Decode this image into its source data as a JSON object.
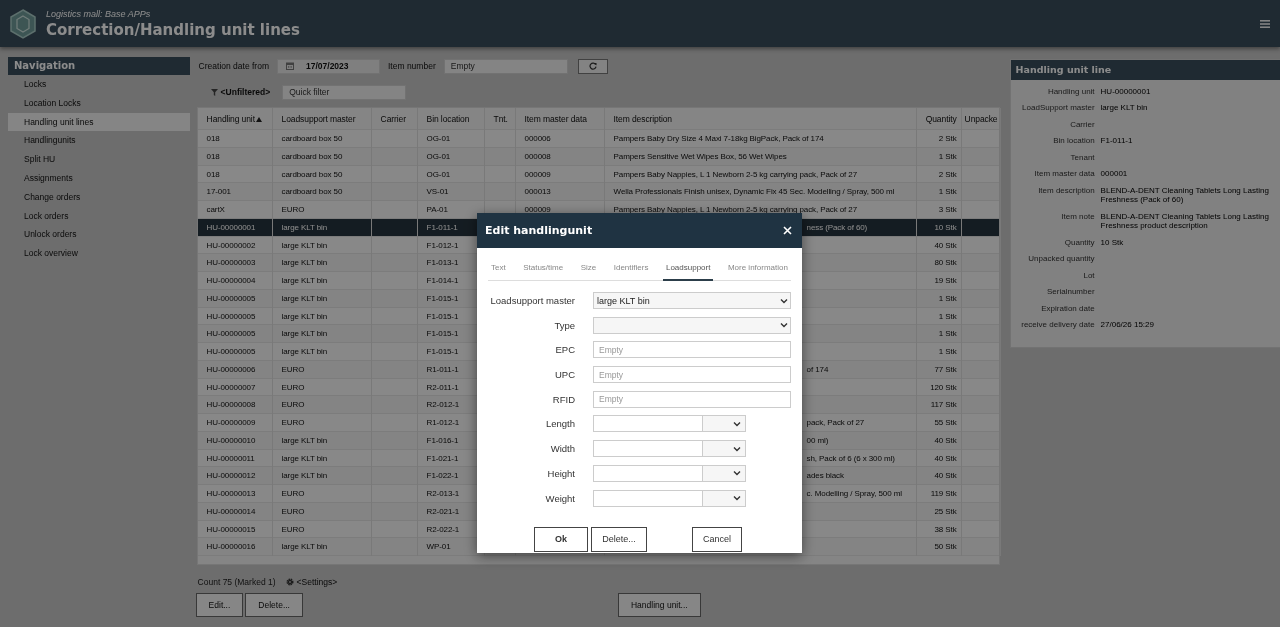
{
  "header": {
    "app_name": "Logistics mall: Base APPs",
    "title": "Correction/Handling unit lines"
  },
  "navigation": {
    "title": "Navigation",
    "items": [
      {
        "label": "Locks",
        "selected": false
      },
      {
        "label": "Location Locks",
        "selected": false
      },
      {
        "label": "Handling unit lines",
        "selected": true
      },
      {
        "label": "Handlingunits",
        "selected": false
      },
      {
        "label": "Split HU",
        "selected": false
      },
      {
        "label": "Assignments",
        "selected": false
      },
      {
        "label": "Change orders",
        "selected": false
      },
      {
        "label": "Lock orders",
        "selected": false
      },
      {
        "label": "Unlock orders",
        "selected": false
      },
      {
        "label": "Lock overview",
        "selected": false
      }
    ]
  },
  "filters": {
    "creation_date_label": "Creation date from",
    "creation_date": "17/07/2023",
    "item_number_label": "Item number",
    "item_number": {
      "placeholder": "Empty"
    },
    "filter_state": "<Unfiltered>",
    "quick_filter": {
      "placeholder": "Quick filter"
    }
  },
  "table": {
    "columns": [
      {
        "label": "Handling unit",
        "sorted": true
      },
      {
        "label": "Loadsupport master",
        "sorted": false
      },
      {
        "label": "Carrier",
        "sorted": false
      },
      {
        "label": "Bin location",
        "sorted": false
      },
      {
        "label": "Tnt.",
        "sorted": false
      },
      {
        "label": "Item master data",
        "sorted": false
      },
      {
        "label": "Item description",
        "sorted": false
      },
      {
        "label": "Quantity",
        "sorted": false
      },
      {
        "label": "Unpacke",
        "sorted": false
      }
    ],
    "rows": [
      {
        "kind": "full",
        "selected": false,
        "handling_unit": "018",
        "loadsupport_master": "cardboard box 50",
        "bin_location": "OG-01",
        "item_master_data": "000006",
        "item_description": "Pampers Baby Dry Size 4 Maxi 7-18kg BigPack, Pack of 174",
        "quantity": "2 Stk"
      },
      {
        "kind": "full",
        "selected": false,
        "handling_unit": "018",
        "loadsupport_master": "cardboard box 50",
        "bin_location": "OG-01",
        "item_master_data": "000008",
        "item_description": "Pampers Sensitive Wet Wipes Box, 56 Wet Wipes",
        "quantity": "1 Stk"
      },
      {
        "kind": "full",
        "selected": false,
        "handling_unit": "018",
        "loadsupport_master": "cardboard box 50",
        "bin_location": "OG-01",
        "item_master_data": "000009",
        "item_description": "Pampers Baby Nappies, L 1 Newborn 2-5 kg carrying pack, Pack of 27",
        "quantity": "2 Stk"
      },
      {
        "kind": "full",
        "selected": false,
        "handling_unit": "17-001",
        "loadsupport_master": "cardboard box 50",
        "bin_location": "VS-01",
        "item_master_data": "000013",
        "item_description": "Wella Professionals Finish unisex, Dynamic Fix 45 Sec. Modelling / Spray, 500 ml",
        "quantity": "1 Stk"
      },
      {
        "kind": "full",
        "selected": false,
        "handling_unit": "cartX",
        "loadsupport_master": "EURO",
        "bin_location": "PA-01",
        "item_master_data": "000009",
        "item_description": "Pampers Baby Nappies, L 1 Newborn 2-5 kg carrying pack, Pack of 27",
        "quantity": "3 Stk"
      },
      {
        "kind": "covered",
        "selected": true,
        "handling_unit": "HU-00000001",
        "loadsupport_master": "large KLT bin",
        "bin_location": "F1-011-1",
        "item_description": "ness (Pack of 60)",
        "quantity": "10 Stk"
      },
      {
        "kind": "covered",
        "selected": false,
        "handling_unit": "HU-00000002",
        "loadsupport_master": "large KLT bin",
        "bin_location": "F1-012-1",
        "quantity": "40 Stk"
      },
      {
        "kind": "covered",
        "selected": false,
        "handling_unit": "HU-00000003",
        "loadsupport_master": "large KLT bin",
        "bin_location": "F1-013-1",
        "quantity": "80 Stk"
      },
      {
        "kind": "covered",
        "selected": false,
        "handling_unit": "HU-00000004",
        "loadsupport_master": "large KLT bin",
        "bin_location": "F1-014-1",
        "quantity": "19 Stk"
      },
      {
        "kind": "covered",
        "selected": false,
        "handling_unit": "HU-00000005",
        "loadsupport_master": "large KLT bin",
        "bin_location": "F1-015-1",
        "quantity": "1 Stk"
      },
      {
        "kind": "covered",
        "selected": false,
        "handling_unit": "HU-00000005",
        "loadsupport_master": "large KLT bin",
        "bin_location": "F1-015-1",
        "quantity": "1 Stk"
      },
      {
        "kind": "covered",
        "selected": false,
        "handling_unit": "HU-00000005",
        "loadsupport_master": "large KLT bin",
        "bin_location": "F1-015-1",
        "quantity": "1 Stk"
      },
      {
        "kind": "covered",
        "selected": false,
        "handling_unit": "HU-00000005",
        "loadsupport_master": "large KLT bin",
        "bin_location": "F1-015-1",
        "quantity": "1 Stk"
      },
      {
        "kind": "covered",
        "selected": false,
        "handling_unit": "HU-00000006",
        "loadsupport_master": "EURO",
        "bin_location": "R1-011-1",
        "item_description": "of 174",
        "quantity": "77 Stk"
      },
      {
        "kind": "covered",
        "selected": false,
        "handling_unit": "HU-00000007",
        "loadsupport_master": "EURO",
        "bin_location": "R2-011-1",
        "quantity": "120 Stk"
      },
      {
        "kind": "covered",
        "selected": false,
        "handling_unit": "HU-00000008",
        "loadsupport_master": "EURO",
        "bin_location": "R2-012-1",
        "quantity": "117 Stk"
      },
      {
        "kind": "covered",
        "selected": false,
        "handling_unit": "HU-00000009",
        "loadsupport_master": "EURO",
        "bin_location": "R1-012-1",
        "item_description": "pack, Pack of 27",
        "quantity": "55 Stk"
      },
      {
        "kind": "covered",
        "selected": false,
        "handling_unit": "HU-00000010",
        "loadsupport_master": "large KLT bin",
        "bin_location": "F1-016-1",
        "item_description": "00 ml)",
        "quantity": "40 Stk"
      },
      {
        "kind": "covered",
        "selected": false,
        "handling_unit": "HU-00000011",
        "loadsupport_master": "large KLT bin",
        "bin_location": "F1-021-1",
        "item_description": "sh, Pack of 6 (6 x 300 ml)",
        "quantity": "40 Stk"
      },
      {
        "kind": "covered",
        "selected": false,
        "handling_unit": "HU-00000012",
        "loadsupport_master": "large KLT bin",
        "bin_location": "F1-022-1",
        "item_description": "ades black",
        "quantity": "40 Stk"
      },
      {
        "kind": "covered",
        "selected": false,
        "handling_unit": "HU-00000013",
        "loadsupport_master": "EURO",
        "bin_location": "R2-013-1",
        "item_description": "c. Modelling / Spray, 500 ml",
        "quantity": "119 Stk"
      },
      {
        "kind": "covered",
        "selected": false,
        "handling_unit": "HU-00000014",
        "loadsupport_master": "EURO",
        "bin_location": "R2-021-1",
        "quantity": "25 Stk"
      },
      {
        "kind": "covered",
        "selected": false,
        "handling_unit": "HU-00000015",
        "loadsupport_master": "EURO",
        "bin_location": "R2-022-1",
        "quantity": "38 Stk"
      },
      {
        "kind": "covered",
        "selected": false,
        "handling_unit": "HU-00000016",
        "loadsupport_master": "large KLT bin",
        "bin_location": "WP-01",
        "quantity": "50 Stk"
      }
    ]
  },
  "footer": {
    "count": "Count 75 (Marked 1)",
    "settings": "<Settings>",
    "buttons": [
      "Edit...",
      "Delete...",
      "Handling unit..."
    ]
  },
  "detail": {
    "title": "Handling unit line",
    "fields": [
      {
        "label": "Handling unit",
        "value": "HU-00000001"
      },
      {
        "label": "LoadSupport master",
        "value": "large KLT bin"
      },
      {
        "label": "Carrier"
      },
      {
        "label": "Bin location",
        "value": "F1-011-1"
      },
      {
        "label": "Tenant"
      },
      {
        "label": "Item master data",
        "value": "000001"
      },
      {
        "label": "Item description",
        "value": "BLEND-A-DENT Cleaning Tablets Long Lasting Freshness (Pack of 60)"
      },
      {
        "label": "Item note",
        "value": "BLEND-A-DENT Cleaning Tablets Long Lasting Freshness product description"
      },
      {
        "label": "Quantity",
        "value": "10 Stk"
      },
      {
        "label": "Unpacked quantity"
      },
      {
        "label": "Lot"
      },
      {
        "label": "Serialnumber"
      },
      {
        "label": "Expiration date"
      },
      {
        "label": "receive delivery date",
        "value": "27/06/26 15:29"
      }
    ]
  },
  "dialog": {
    "title": "Edit handlingunit",
    "tabs": [
      {
        "label": "Text",
        "selected": false
      },
      {
        "label": "Status/time",
        "selected": false
      },
      {
        "label": "Size",
        "selected": false
      },
      {
        "label": "Identifiers",
        "selected": false
      },
      {
        "label": "Loadsupport",
        "selected": true
      },
      {
        "label": "More information",
        "selected": false
      }
    ],
    "fields": [
      {
        "kind": "select",
        "label": "Loadsupport master",
        "value": "large KLT bin"
      },
      {
        "kind": "select",
        "label": "Type"
      },
      {
        "kind": "text",
        "label": "EPC",
        "placeholder": "Empty"
      },
      {
        "kind": "text",
        "label": "UPC",
        "placeholder": "Empty"
      },
      {
        "kind": "text",
        "label": "RFID",
        "placeholder": "Empty"
      },
      {
        "kind": "dimension",
        "label": "Length"
      },
      {
        "kind": "dimension",
        "label": "Width"
      },
      {
        "kind": "dimension",
        "label": "Height"
      },
      {
        "kind": "dimension",
        "label": "Weight"
      }
    ],
    "buttons": [
      {
        "label": "Ok",
        "default": true
      },
      {
        "label": "Delete...",
        "default": false
      },
      {
        "label": "Cancel",
        "default": false
      }
    ]
  }
}
